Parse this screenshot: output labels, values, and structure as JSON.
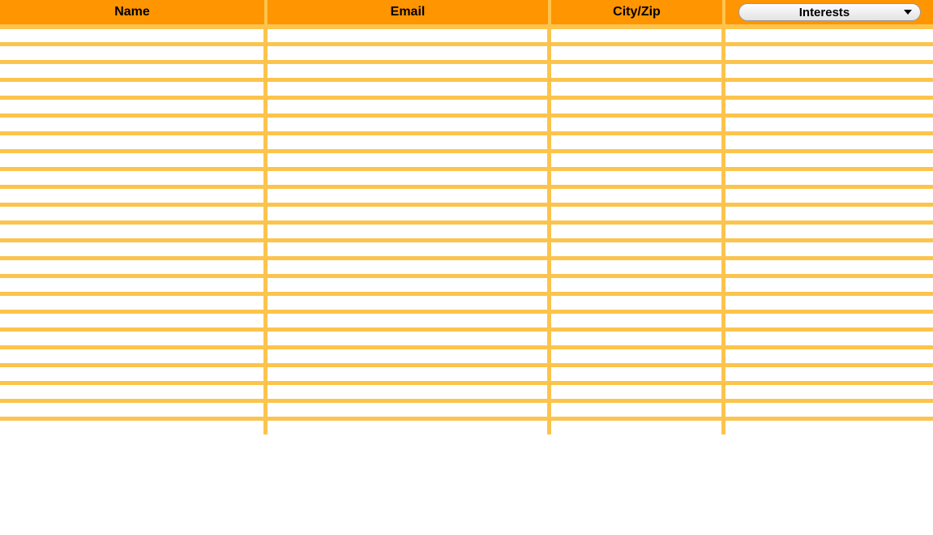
{
  "table": {
    "columns": [
      {
        "label": "Name"
      },
      {
        "label": "Email"
      },
      {
        "label": "City/Zip"
      },
      {
        "label": "Interests",
        "is_dropdown": true
      }
    ],
    "rows": [
      {
        "name": "",
        "email": "",
        "cityzip": "",
        "interests": ""
      },
      {
        "name": "",
        "email": "",
        "cityzip": "",
        "interests": ""
      },
      {
        "name": "",
        "email": "",
        "cityzip": "",
        "interests": ""
      },
      {
        "name": "",
        "email": "",
        "cityzip": "",
        "interests": ""
      },
      {
        "name": "",
        "email": "",
        "cityzip": "",
        "interests": ""
      },
      {
        "name": "",
        "email": "",
        "cityzip": "",
        "interests": ""
      },
      {
        "name": "",
        "email": "",
        "cityzip": "",
        "interests": ""
      },
      {
        "name": "",
        "email": "",
        "cityzip": "",
        "interests": ""
      },
      {
        "name": "",
        "email": "",
        "cityzip": "",
        "interests": ""
      },
      {
        "name": "",
        "email": "",
        "cityzip": "",
        "interests": ""
      },
      {
        "name": "",
        "email": "",
        "cityzip": "",
        "interests": ""
      },
      {
        "name": "",
        "email": "",
        "cityzip": "",
        "interests": ""
      },
      {
        "name": "",
        "email": "",
        "cityzip": "",
        "interests": ""
      },
      {
        "name": "",
        "email": "",
        "cityzip": "",
        "interests": ""
      },
      {
        "name": "",
        "email": "",
        "cityzip": "",
        "interests": ""
      },
      {
        "name": "",
        "email": "",
        "cityzip": "",
        "interests": ""
      },
      {
        "name": "",
        "email": "",
        "cityzip": "",
        "interests": ""
      },
      {
        "name": "",
        "email": "",
        "cityzip": "",
        "interests": ""
      },
      {
        "name": "",
        "email": "",
        "cityzip": "",
        "interests": ""
      },
      {
        "name": "",
        "email": "",
        "cityzip": "",
        "interests": ""
      },
      {
        "name": "",
        "email": "",
        "cityzip": "",
        "interests": ""
      },
      {
        "name": "",
        "email": "",
        "cityzip": "",
        "interests": ""
      },
      {
        "name": "",
        "email": "",
        "cityzip": "",
        "interests": ""
      }
    ]
  }
}
